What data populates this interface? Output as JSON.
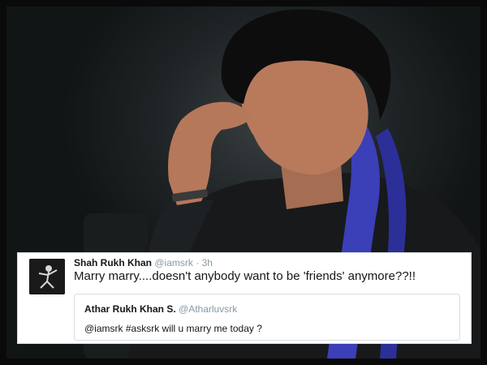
{
  "tweet": {
    "author_name": "Shah Rukh Khan",
    "author_handle": "@iamsrk",
    "separator": "·",
    "time": "3h",
    "text": "Marry marry....doesn't anybody want to be 'friends' anymore??!!",
    "quoted": {
      "author_name": "Athar Rukh Khan S.",
      "author_handle": "@Atharluvsrk",
      "text": "@iamsrk #asksrk will u marry me today ?"
    }
  },
  "colors": {
    "name": "#14171a",
    "muted": "#8899a6",
    "scarf": "#3b3fb8"
  }
}
